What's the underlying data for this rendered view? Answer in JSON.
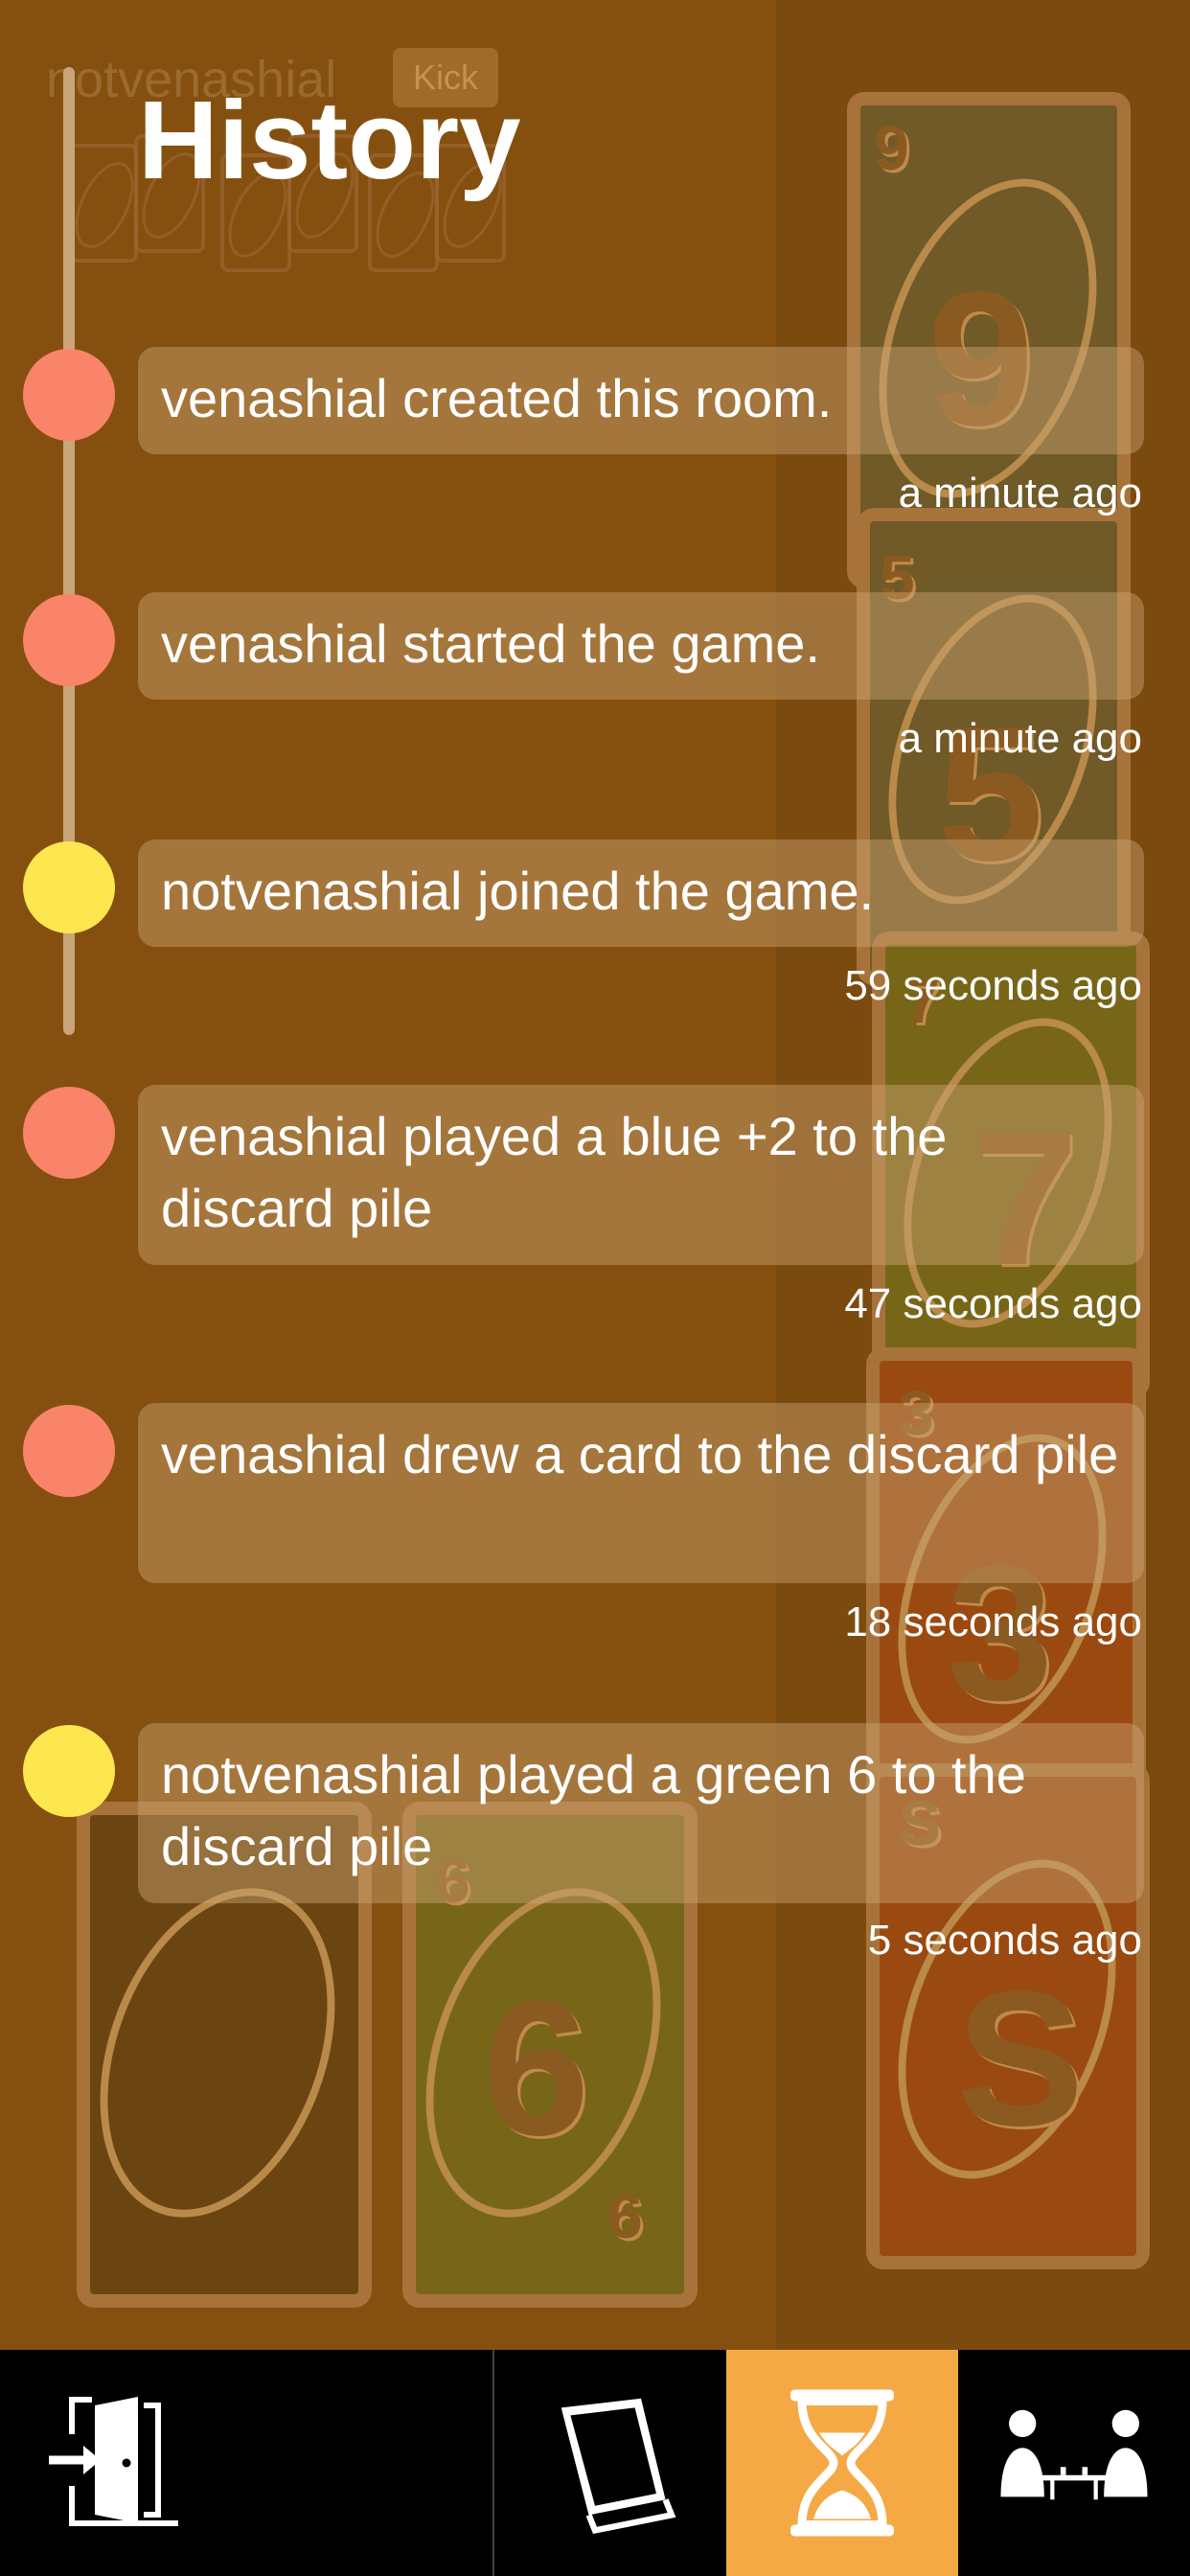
{
  "colors": {
    "background": "#85500f",
    "dot_red": "#fa8469",
    "dot_yellow": "#fce74e",
    "tab_active": "#f5a945",
    "tabbar": "#000000"
  },
  "background_game": {
    "player_name": "notvenashial",
    "kick_label": "Kick",
    "pile_cards": [
      "9",
      "5",
      "7",
      "3",
      "S"
    ],
    "hand_card": "6"
  },
  "history": {
    "title": "History",
    "entries": [
      {
        "text": "venashial created this room.",
        "time": "a minute ago",
        "dot": "red"
      },
      {
        "text": "venashial started the game.",
        "time": "a minute ago",
        "dot": "red"
      },
      {
        "text": "notvenashial joined the game.",
        "time": "59 seconds ago",
        "dot": "yellow"
      },
      {
        "text": "venashial played a blue +2 to the discard pile",
        "time": "47 seconds ago",
        "dot": "red"
      },
      {
        "text": "venashial drew a card to the discard pile",
        "time": "18 seconds ago",
        "dot": "red"
      },
      {
        "text": "notvenashial played a green 6 to the discard pile",
        "time": "5 seconds ago",
        "dot": "yellow"
      }
    ]
  },
  "tabbar": {
    "tabs": [
      {
        "icon": "exit-door-icon",
        "active": false
      },
      {
        "icon": "book-icon",
        "active": false
      },
      {
        "icon": "hourglass-icon",
        "active": true
      },
      {
        "icon": "players-table-icon",
        "active": false
      }
    ]
  }
}
